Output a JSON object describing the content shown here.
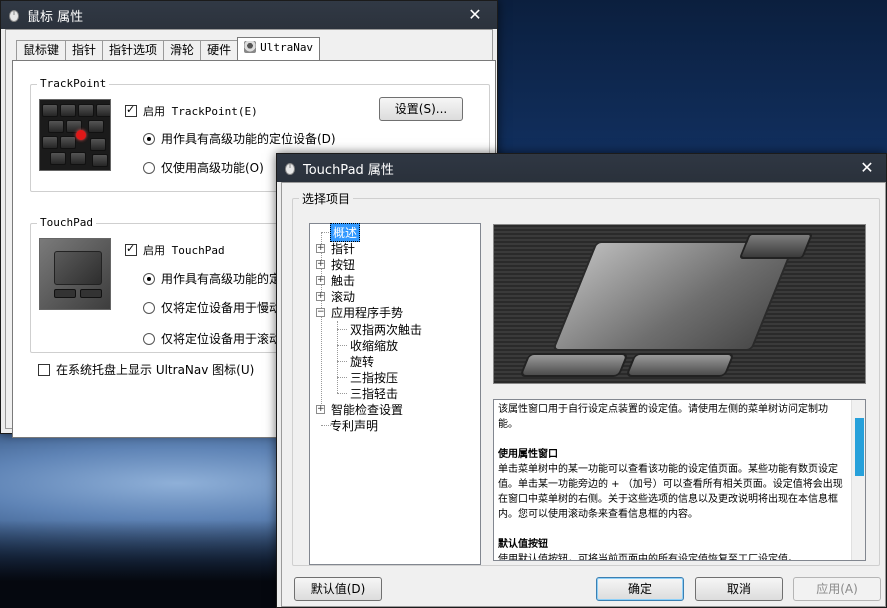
{
  "mouse_window": {
    "title": "鼠标 属性",
    "tabs": [
      "鼠标键",
      "指针",
      "指针选项",
      "滑轮",
      "硬件",
      "UltraNav"
    ],
    "trackpoint": {
      "group_label": "TrackPoint",
      "enable_label": "启用 TrackPoint(E)",
      "settings_button": "设置(S)...",
      "radio_full": "用作具有高级功能的定位设备(D)",
      "radio_adv_only": "仅使用高级功能(O)"
    },
    "touchpad": {
      "group_label": "TouchPad",
      "enable_label": "启用 TouchPad",
      "radio_full": "用作具有高级功能的定位",
      "radio_slow": "仅将定位设备用于慢动",
      "radio_scroll": "仅将定位设备用于滚动"
    },
    "tray_label": "在系统托盘上显示 UltraNav 图标(U)"
  },
  "touchpad_window": {
    "title": "TouchPad 属性",
    "select_group_label": "选择项目",
    "tree": [
      {
        "label": "概述",
        "level": 0,
        "expander": false,
        "selected": true
      },
      {
        "label": "指针",
        "level": 0,
        "expander": true
      },
      {
        "label": "按钮",
        "level": 0,
        "expander": true
      },
      {
        "label": "触击",
        "level": 0,
        "expander": true
      },
      {
        "label": "滚动",
        "level": 0,
        "expander": true
      },
      {
        "label": "应用程序手势",
        "level": 0,
        "expander": true,
        "expanded": true
      },
      {
        "label": "双指两次触击",
        "level": 1
      },
      {
        "label": "收缩缩放",
        "level": 1
      },
      {
        "label": "旋转",
        "level": 1
      },
      {
        "label": "三指按压",
        "level": 1
      },
      {
        "label": "三指轻击",
        "level": 1
      },
      {
        "label": "智能检查设置",
        "level": 0,
        "expander": true
      },
      {
        "label": "专利声明",
        "level": 0,
        "expander": false
      }
    ],
    "info": {
      "p1": "该属性窗口用于自行设定点装置的设定值。请使用左侧的菜单树访问定制功能。",
      "h2": "使用属性窗口",
      "p2": "单击菜单树中的某一功能可以查看该功能的设定值页面。某些功能有数页设定值。单击某一功能旁边的 + （加号）可以查看所有相关页面。设定值将会出现在窗口中菜单树的右侧。关于这些选项的信息以及更改说明将出现在本信息框内。您可以使用滚动条来查看信息框的内容。",
      "h3": "默认值按钮",
      "p3": "使用默认值按钮，可将当前页面中的所有设定值恢复至工厂设定值。"
    },
    "buttons": {
      "defaults": "默认值(D)",
      "ok": "确定",
      "cancel": "取消",
      "apply": "应用(A)"
    }
  }
}
